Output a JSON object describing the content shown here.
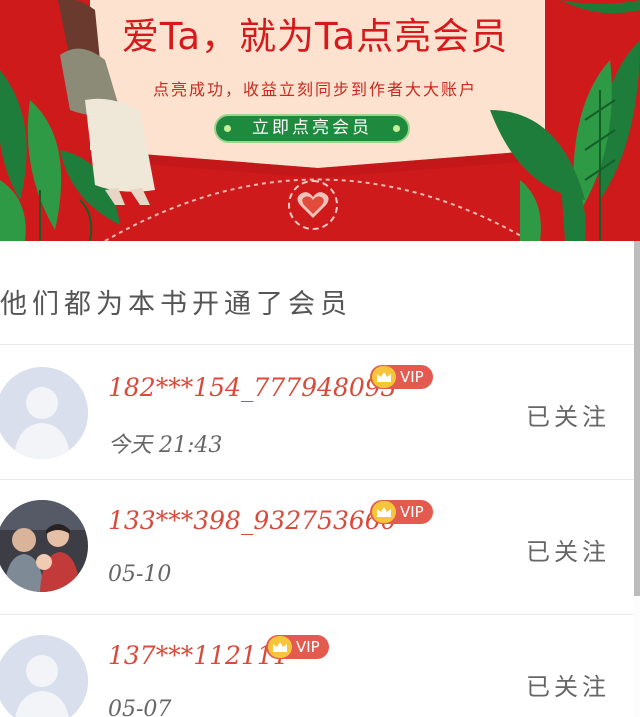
{
  "banner": {
    "title": "爱Ta，就为Ta点亮会员",
    "subtitle": "点亮成功，收益立刻同步到作者大大账户",
    "cta_label": "立即点亮会员",
    "background_color": "#cf1a1c",
    "cta_color": "#1d8a3d"
  },
  "section": {
    "title": "他们都为本书开通了会员"
  },
  "members": [
    {
      "username": "182***154_777948093",
      "badge": "VIP",
      "time": "今天 21:43",
      "follow_label": "已关注",
      "avatar": "default-avatar"
    },
    {
      "username": "133***398_932753660",
      "badge": "VIP",
      "time": "05-10",
      "follow_label": "已关注",
      "avatar": "photo-avatar"
    },
    {
      "username": "137***112111",
      "badge": "VIP",
      "time": "05-07",
      "follow_label": "已关注",
      "avatar": "default-avatar"
    }
  ],
  "colors": {
    "accent_red": "#d84a3a",
    "vip_badge": "#e35a4f",
    "crown": "#f6c53b"
  }
}
